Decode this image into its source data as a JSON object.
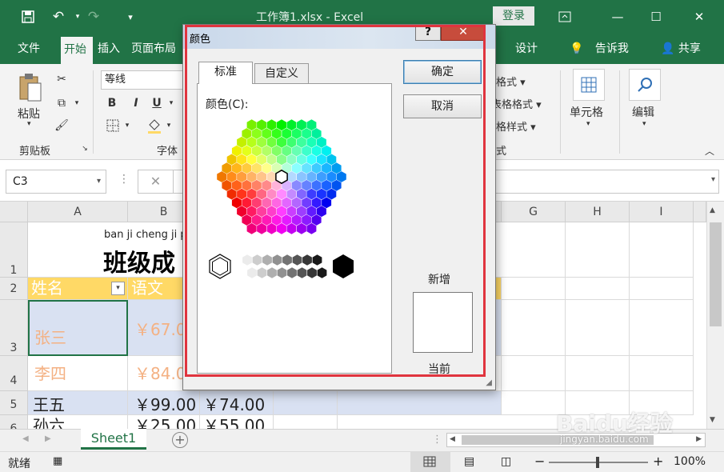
{
  "window": {
    "title": "工作簿1.xlsx  -  Excel",
    "login_label": "登录"
  },
  "ribbon_tabs": [
    {
      "label": "文件",
      "active": false
    },
    {
      "label": "开始",
      "active": true
    },
    {
      "label": "插入",
      "active": false
    },
    {
      "label": "页面布局",
      "active": false
    },
    {
      "label": "设计",
      "active": false
    },
    {
      "label": "告诉我",
      "active": false
    },
    {
      "label": "共享",
      "active": false
    }
  ],
  "ribbon": {
    "paste_label": "粘贴",
    "clipboard_label": "剪贴板",
    "font_name": "等线",
    "font_group_label": "字体",
    "bold": "B",
    "italic": "I",
    "underline": "U",
    "style_items": [
      "格式",
      "表格格式",
      "格样式"
    ],
    "styles_group_tail": "式",
    "cells_label": "单元格",
    "edit_label": "编辑"
  },
  "formula_bar": {
    "name_box": "C3",
    "cancel_symbol": "✕"
  },
  "grid": {
    "columns": [
      "A",
      "B",
      "G",
      "H",
      "I"
    ],
    "rows": [
      "1",
      "2",
      "3",
      "4",
      "5",
      "6"
    ],
    "title_pinyin": "ban ji cheng ji p",
    "title_text": "班级成",
    "header_row": [
      "姓名",
      "语文"
    ],
    "data_rows": [
      [
        "张三",
        "￥67.0"
      ],
      [
        "李四",
        "￥84.0"
      ],
      [
        "王五",
        "￥99.00",
        "￥74.00"
      ],
      [
        "孙六",
        "￥25.00",
        "￥55.00"
      ]
    ]
  },
  "sheet_tabs": [
    "Sheet1"
  ],
  "status": {
    "ready": "就绪",
    "zoom": "100%"
  },
  "dialog": {
    "title": "颜色",
    "help": "?",
    "close": "✕",
    "tabs": [
      "标准",
      "自定义"
    ],
    "color_label": "颜色(C):",
    "ok_label": "确定",
    "cancel_label": "取消",
    "new_label": "新增",
    "current_label": "当前"
  },
  "watermark": {
    "text": "Baidu经验",
    "sub": "jingyan.baidu.com"
  },
  "colors": {
    "excel_green": "#217346",
    "header_fill": "#ffd966",
    "cell_band": "#d9e1f2",
    "highlight_red": "#e0343e",
    "gold_text": "#f4b183"
  }
}
